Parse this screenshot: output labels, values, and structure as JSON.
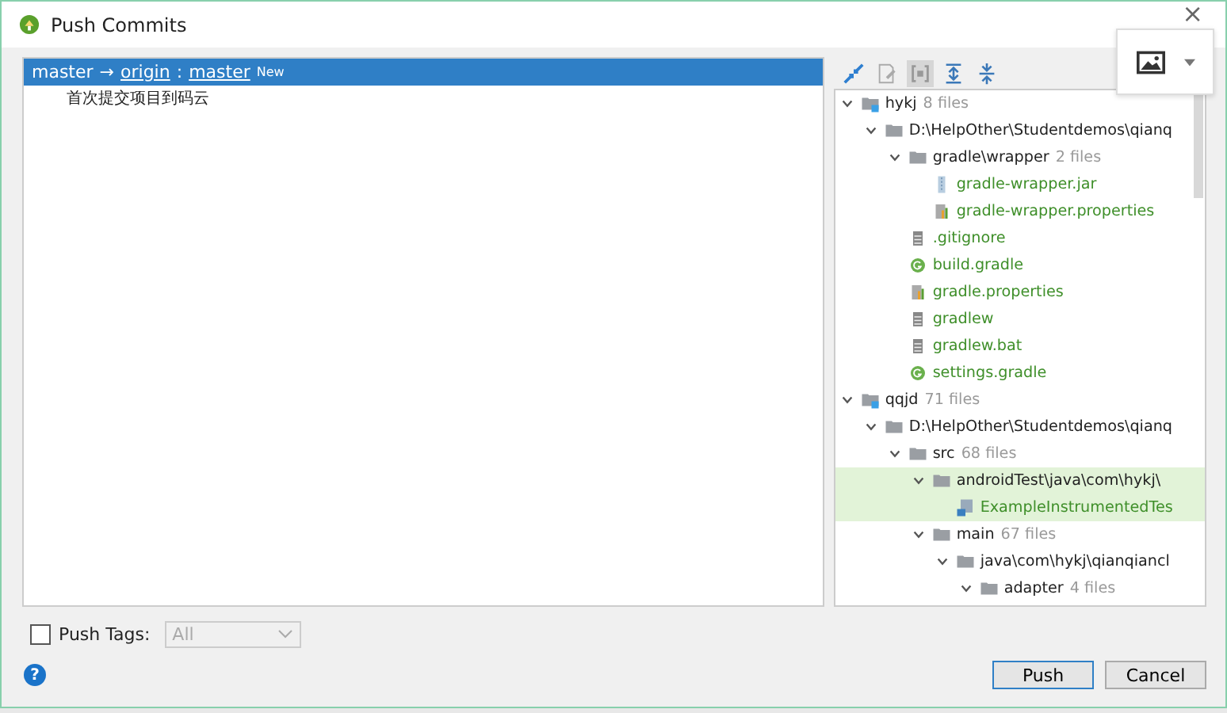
{
  "window": {
    "title": "Push Commits"
  },
  "push_spec": {
    "selected": true,
    "local_branch": "master",
    "arrow": "→",
    "remote": "origin",
    "separator": ":",
    "remote_branch": "master",
    "badge": "New",
    "commits": [
      "首次提交项目到码云"
    ]
  },
  "toolbar": [
    {
      "kind": "expand-plus"
    },
    {
      "kind": "edit-source"
    },
    {
      "kind": "group-by"
    },
    {
      "kind": "expand-all"
    },
    {
      "kind": "collapse-all"
    }
  ],
  "tree": [
    {
      "label": "hykj",
      "count": "8 files",
      "kind": "module",
      "expanded": true,
      "selected": false,
      "color": "#222222",
      "children": [
        {
          "label": "D:\\HelpOther\\Studentdemos\\qianq",
          "kind": "folder",
          "expanded": true,
          "selected": false,
          "color": "#222222",
          "children": [
            {
              "label": "gradle\\wrapper",
              "count": "2 files",
              "kind": "folder",
              "expanded": true,
              "selected": false,
              "color": "#222222",
              "children": [
                {
                  "label": "gradle-wrapper.jar",
                  "kind": "jar",
                  "selected": false,
                  "color": "#3f8f2a"
                },
                {
                  "label": "gradle-wrapper.properties",
                  "kind": "properties",
                  "selected": false,
                  "color": "#3f8f2a"
                }
              ]
            },
            {
              "label": ".gitignore",
              "kind": "text",
              "selected": false,
              "color": "#3f8f2a"
            },
            {
              "label": "build.gradle",
              "kind": "gradle",
              "selected": false,
              "color": "#3f8f2a"
            },
            {
              "label": "gradle.properties",
              "kind": "properties",
              "selected": false,
              "color": "#3f8f2a"
            },
            {
              "label": "gradlew",
              "kind": "text",
              "selected": false,
              "color": "#3f8f2a"
            },
            {
              "label": "gradlew.bat",
              "kind": "text",
              "selected": false,
              "color": "#3f8f2a"
            },
            {
              "label": "settings.gradle",
              "kind": "gradle",
              "selected": false,
              "color": "#3f8f2a"
            }
          ]
        }
      ]
    },
    {
      "label": "qqjd",
      "count": "71 files",
      "kind": "module",
      "expanded": true,
      "selected": false,
      "color": "#222222",
      "children": [
        {
          "label": "D:\\HelpOther\\Studentdemos\\qianq",
          "kind": "folder",
          "expanded": true,
          "selected": false,
          "color": "#222222",
          "children": [
            {
              "label": "src",
              "count": "68 files",
              "kind": "folder",
              "expanded": true,
              "selected": false,
              "color": "#222222",
              "children": [
                {
                  "label": "androidTest\\java\\com\\hykj\\",
                  "kind": "folder",
                  "expanded": true,
                  "selected": true,
                  "color": "#222222",
                  "children": [
                    {
                      "label": "ExampleInstrumentedTes",
                      "kind": "java",
                      "selected": true,
                      "color": "#3f8f2a"
                    }
                  ]
                },
                {
                  "label": "main",
                  "count": "67 files",
                  "kind": "folder",
                  "expanded": true,
                  "selected": false,
                  "color": "#222222",
                  "children": [
                    {
                      "label": "java\\com\\hykj\\qianqiancl",
                      "kind": "folder",
                      "expanded": true,
                      "selected": false,
                      "color": "#222222",
                      "children": [
                        {
                          "label": "adapter",
                          "count": "4 files",
                          "kind": "folder",
                          "expanded": true,
                          "selected": false,
                          "color": "#222222"
                        }
                      ]
                    }
                  ]
                }
              ]
            }
          ]
        }
      ]
    }
  ],
  "push_tags": {
    "label": "Push Tags:",
    "checked": false,
    "value": "All",
    "disabled": true
  },
  "buttons": [
    {
      "label": "Push",
      "default": true
    },
    {
      "label": "Cancel",
      "default": false
    }
  ],
  "help": "?",
  "close": "×"
}
